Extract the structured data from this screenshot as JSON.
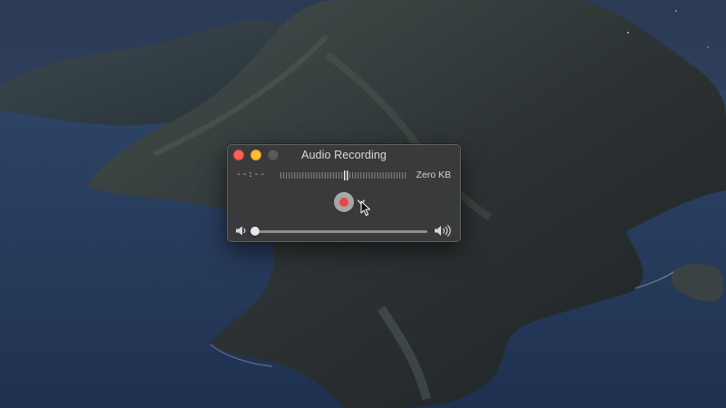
{
  "window": {
    "title": "Audio Recording"
  },
  "recording": {
    "time": "--:--",
    "file_size": "Zero KB",
    "level": 0.5
  },
  "volume": {
    "level": 0.0
  },
  "icons": {
    "close": "close-icon",
    "minimize": "minimize-icon",
    "zoom": "zoom-icon",
    "record": "record-icon",
    "options": "chevron-down-icon",
    "volume_low": "speaker-low-icon",
    "volume_high": "speaker-high-icon"
  },
  "colors": {
    "close": "#fe5f57",
    "minimize": "#febc2e",
    "zoom": "#5b5b5e",
    "record_dot": "#e8444a",
    "window_bg": "#3a3a3c"
  }
}
